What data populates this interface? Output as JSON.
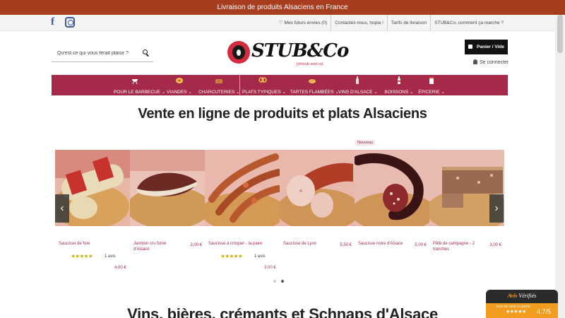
{
  "topbar": {
    "text": "Livraison de produits Alsaciens en France"
  },
  "util": {
    "links": [
      "♡ Mes futurs envies (0)",
      "Contactez-nous, hopla !",
      "Tarifs de livraison",
      "STUB&Co, comment ça marche ?"
    ]
  },
  "search": {
    "placeholder": "Qu'est ce qui vous ferait plaisir ?"
  },
  "logo": {
    "text": "STUB&Co",
    "tagline": "[chtoub and co]"
  },
  "cart": {
    "label": "Panier / Vide"
  },
  "account": {
    "login_label": "Se connecter"
  },
  "nav": {
    "items": [
      {
        "label": "POUR LE BARBECUE"
      },
      {
        "label": "VIANDES"
      },
      {
        "label": "CHARCUTERIES"
      },
      {
        "label": "PLATS TYPIQUES"
      },
      {
        "label": "TARTES FLAMBÉES"
      },
      {
        "label": "VINS D'ALSACE"
      },
      {
        "label": "BOISSONS"
      },
      {
        "label": "ÉPICERIE"
      }
    ],
    "colors": {
      "bar": "#a52a4a"
    }
  },
  "main": {
    "heading": "Vente en ligne de produits et plats Alsaciens",
    "heading2": "Vins, bières, crémants et Schnaps d'Alsace",
    "badge": "Nouveau"
  },
  "products": [
    {
      "name": "Saucisse de foie",
      "price": "4,00 €",
      "rating": "★★★★★",
      "reviews": "1 avis"
    },
    {
      "name": "Jambon cru fumé d'Alsace",
      "price": "3,00 €"
    },
    {
      "name": "Saucisse à croquer - la paire",
      "price": "3,00 €",
      "rating": "★★★★★",
      "reviews": "1 avis"
    },
    {
      "name": "Saucisse de Lyon",
      "price": "5,50 €"
    },
    {
      "name": "Saucisse noire d'Alsace",
      "price": "5,00 €"
    },
    {
      "name": "Pâté de campagne - 2 tranches",
      "price": "3,00 €"
    }
  ],
  "carousel": {
    "prev": "‹",
    "next": "›"
  },
  "verified": {
    "title_a": "Avis",
    "title_b": "Vérifiés",
    "sub": "AVIS DE NOS CLIENTS",
    "stars": "★★★★★",
    "score": "4.7/5"
  }
}
